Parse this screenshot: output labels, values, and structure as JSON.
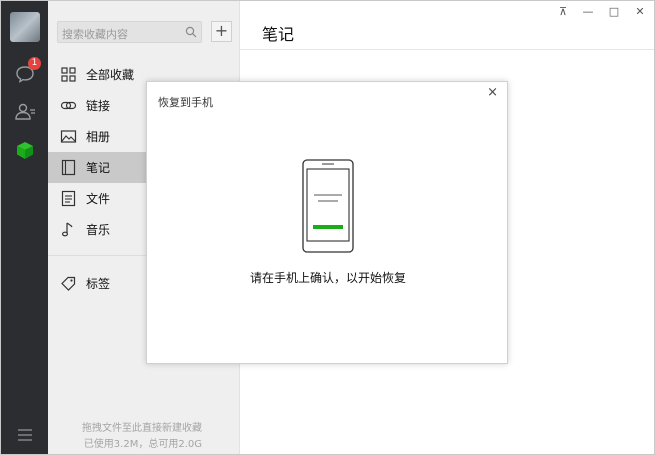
{
  "rail": {
    "chat_badge": "1",
    "accent_color": "#1aad19",
    "icons": [
      "chat-icon",
      "contacts-icon",
      "favorites-cube-icon",
      "menu-icon"
    ]
  },
  "sidebar": {
    "search_placeholder": "搜索收藏内容",
    "add_label": "+",
    "items": [
      {
        "label": "全部收藏",
        "icon": "grid-icon",
        "active": false
      },
      {
        "label": "链接",
        "icon": "link-icon",
        "active": false
      },
      {
        "label": "相册",
        "icon": "photo-icon",
        "active": false
      },
      {
        "label": "笔记",
        "icon": "note-icon",
        "active": true
      },
      {
        "label": "文件",
        "icon": "file-icon",
        "active": false
      },
      {
        "label": "音乐",
        "icon": "music-icon",
        "active": false
      },
      {
        "label": "标签",
        "icon": "tag-icon",
        "active": false
      }
    ],
    "footer_line1": "拖拽文件至此直接新建收藏",
    "footer_line2": "已使用3.2M，总可用2.0G"
  },
  "main": {
    "title": "笔记"
  },
  "window": {
    "pin": "⊼",
    "minimize": "—",
    "maximize": "□",
    "close": "✕"
  },
  "modal": {
    "title": "恢复到手机",
    "close": "×",
    "message": "请在手机上确认，以开始恢复"
  }
}
